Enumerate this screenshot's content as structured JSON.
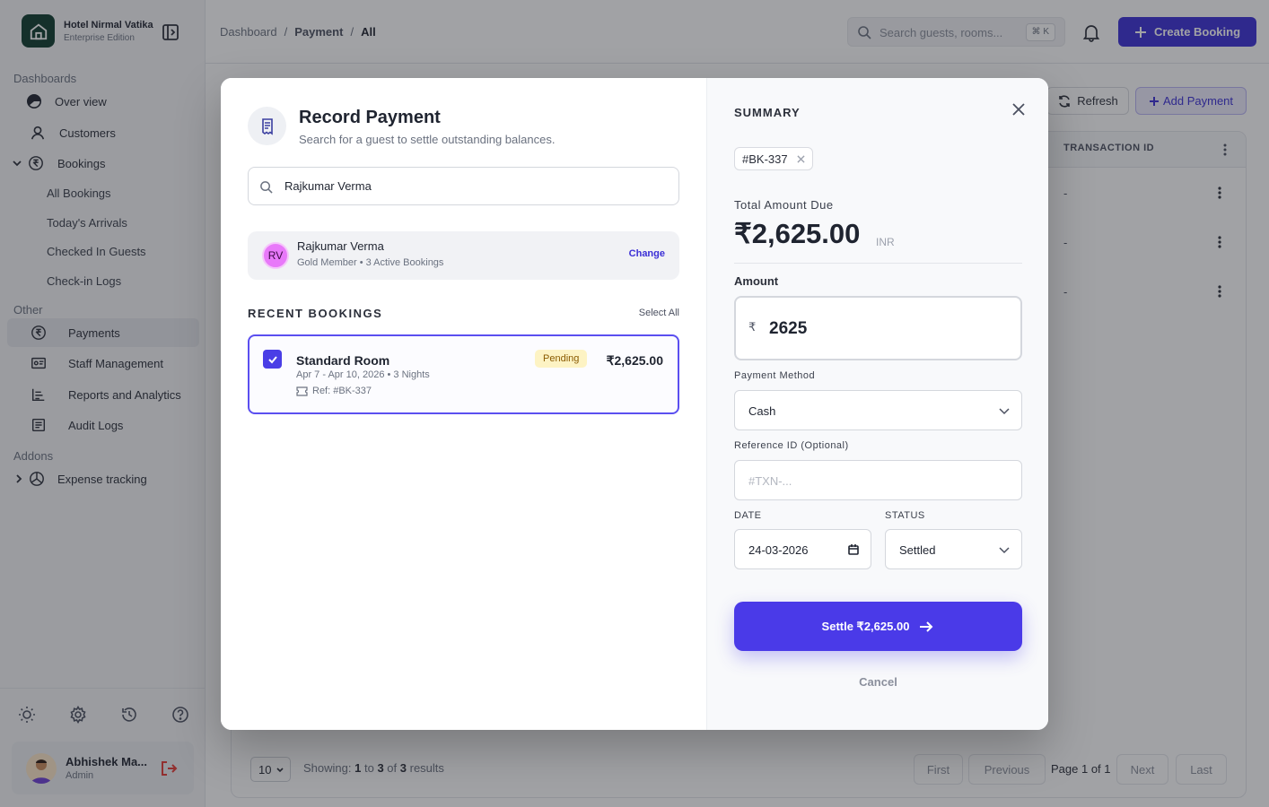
{
  "brand": {
    "name": "Hotel Nirmal Vatika",
    "edition": "Enterprise Edition"
  },
  "sidebar": {
    "sections": {
      "dashboards": "Dashboards",
      "other": "Other",
      "addons": "Addons"
    },
    "items": {
      "overview": "Over view",
      "customers": "Customers",
      "bookings": "Bookings",
      "all_bookings": "All Bookings",
      "todays_arrivals": "Today's Arrivals",
      "checked_in": "Checked In Guests",
      "checkin_logs": "Check-in Logs",
      "payments": "Payments",
      "staff": "Staff Management",
      "reports": "Reports and Analytics",
      "audit": "Audit Logs",
      "expense": "Expense tracking"
    },
    "user": {
      "name": "Abhishek Ma...",
      "role": "Admin"
    }
  },
  "header": {
    "breadcrumb": [
      "Dashboard",
      "/",
      "Payment",
      "/",
      "All"
    ],
    "search_placeholder": "Search guests, rooms...",
    "search_shortcut": "⌘ K",
    "create_label": "Create Booking"
  },
  "main": {
    "refresh_label": "Refresh",
    "add_payment_label": "Add Payment",
    "column_transaction": "TRANSACTION ID",
    "rows": [
      "-",
      "-",
      "-"
    ],
    "page_size": "10",
    "showing": {
      "prefix": "Showing:",
      "from": "1",
      "to_word": "to",
      "to": "3",
      "of_word": "of",
      "total": "3",
      "suffix": "results"
    },
    "pagination": {
      "first": "First",
      "previous": "Previous",
      "page_label": "Page 1 of 1",
      "next": "Next",
      "last": "Last"
    }
  },
  "modal": {
    "title": "Record Payment",
    "subtitle": "Search for a guest to settle outstanding balances.",
    "search_value": "Rajkumar Verma",
    "guest": {
      "initials": "RV",
      "name": "Rajkumar Verma",
      "meta": "Gold Member • 3 Active Bookings",
      "change_label": "Change"
    },
    "recent_title": "RECENT BOOKINGS",
    "select_all": "Select All",
    "booking": {
      "room": "Standard Room",
      "dates": "Apr 7 - Apr 10, 2026  •  3 Nights",
      "ref": "Ref: #BK-337",
      "status": "Pending",
      "amount": "₹2,625.00"
    },
    "summary": {
      "title": "SUMMARY",
      "chip": "#BK-337",
      "total_label": "Total Amount Due",
      "total_value": "₹2,625.00",
      "currency": "INR",
      "amount_label": "Amount",
      "amount_symbol": "₹",
      "amount_value": "2625",
      "method_label": "Payment Method",
      "method_value": "Cash",
      "ref_label": "Reference ID (Optional)",
      "ref_placeholder": "#TXN-...",
      "date_label": "DATE",
      "date_value": "24-03-2026",
      "status_label": "STATUS",
      "status_value": "Settled",
      "settle_label": "Settle ₹2,625.00",
      "cancel_label": "Cancel"
    }
  },
  "colors": {
    "primary": "#4a3ae8",
    "brand_dark": "#0f3b2e",
    "pending_bg": "#fdf3c4"
  }
}
